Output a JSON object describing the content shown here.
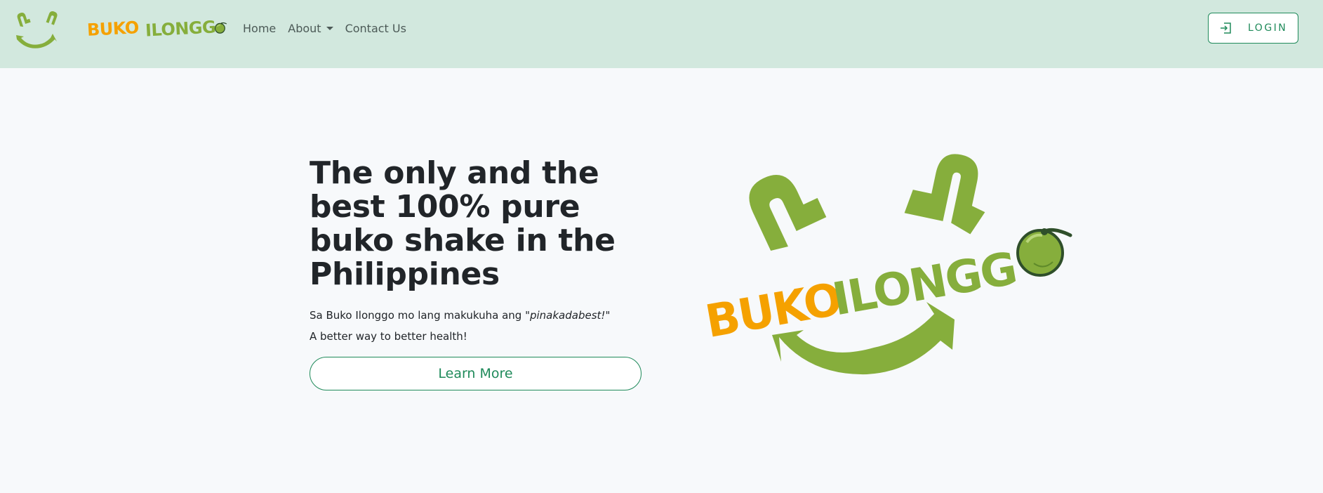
{
  "brand": {
    "word1": "BUKO",
    "word2": "ILONGG",
    "colors": {
      "orange": "#f5a100",
      "green": "#86ae3c",
      "dark_green": "#2f4f2a"
    }
  },
  "nav": {
    "items": [
      {
        "label": "Home",
        "dropdown": false
      },
      {
        "label": "About",
        "dropdown": true
      },
      {
        "label": "Contact Us",
        "dropdown": false
      }
    ],
    "login_label": "LOGIN",
    "login_icon": "login-icon"
  },
  "hero": {
    "title": "The only and the best 100% pure buko shake in the Philippines",
    "tagline_prefix": "Sa Buko Ilonggo mo lang makukuha ang \"",
    "tagline_emphasis": "pinakadabest!",
    "tagline_suffix": "\"",
    "subtext": "A better way to better health!",
    "cta_label": "Learn More"
  },
  "theme": {
    "navbar_bg": "#d2e8de",
    "page_bg": "#f7f9fb",
    "accent": "#1f8a5a"
  }
}
